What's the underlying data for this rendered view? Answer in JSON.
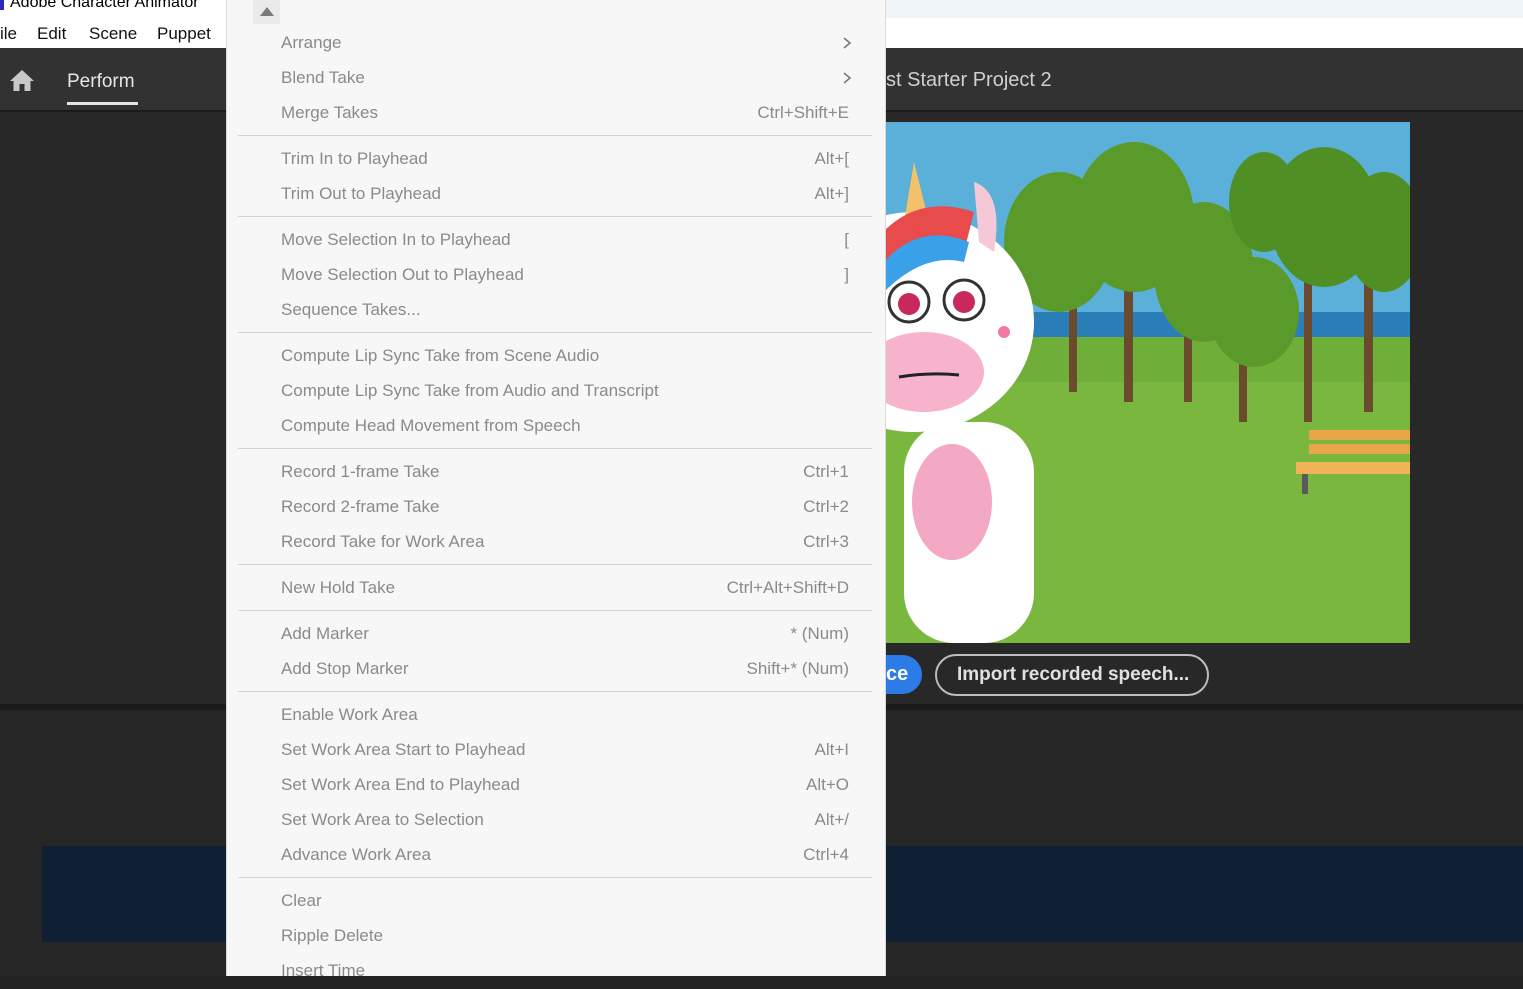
{
  "window": {
    "title": "Adobe Character Animator"
  },
  "menubar": {
    "items": [
      "ile",
      "Edit",
      "Scene",
      "Puppet"
    ]
  },
  "header": {
    "workspace_tab": "Perform",
    "project_title": "st Starter Project 2"
  },
  "scene_buttons": {
    "partial_button_text": "ce",
    "import_label": "Import recorded speech..."
  },
  "menu": {
    "groups": [
      [
        {
          "label": "Arrange",
          "shortcut": "",
          "submenu": true
        },
        {
          "label": "Blend Take",
          "shortcut": "",
          "submenu": true
        },
        {
          "label": "Merge Takes",
          "shortcut": "Ctrl+Shift+E"
        }
      ],
      [
        {
          "label": "Trim In to Playhead",
          "shortcut": "Alt+["
        },
        {
          "label": "Trim Out to Playhead",
          "shortcut": "Alt+]"
        }
      ],
      [
        {
          "label": "Move Selection In to Playhead",
          "shortcut": "["
        },
        {
          "label": "Move Selection Out to Playhead",
          "shortcut": "]"
        },
        {
          "label": "Sequence Takes...",
          "shortcut": ""
        }
      ],
      [
        {
          "label": "Compute Lip Sync Take from Scene Audio",
          "shortcut": ""
        },
        {
          "label": "Compute Lip Sync Take from Audio and Transcript",
          "shortcut": ""
        },
        {
          "label": "Compute Head Movement from Speech",
          "shortcut": ""
        }
      ],
      [
        {
          "label": "Record 1-frame Take",
          "shortcut": "Ctrl+1"
        },
        {
          "label": "Record 2-frame Take",
          "shortcut": "Ctrl+2"
        },
        {
          "label": "Record Take for Work Area",
          "shortcut": "Ctrl+3"
        }
      ],
      [
        {
          "label": "New Hold Take",
          "shortcut": "Ctrl+Alt+Shift+D"
        }
      ],
      [
        {
          "label": "Add Marker",
          "shortcut": "* (Num)"
        },
        {
          "label": "Add Stop Marker",
          "shortcut": "Shift+* (Num)"
        }
      ],
      [
        {
          "label": "Enable Work Area",
          "shortcut": ""
        },
        {
          "label": "Set Work Area Start to Playhead",
          "shortcut": "Alt+I"
        },
        {
          "label": "Set Work Area End to Playhead",
          "shortcut": "Alt+O"
        },
        {
          "label": "Set Work Area to Selection",
          "shortcut": "Alt+/"
        },
        {
          "label": "Advance Work Area",
          "shortcut": "Ctrl+4"
        }
      ],
      [
        {
          "label": "Clear",
          "shortcut": ""
        },
        {
          "label": "Ripple Delete",
          "shortcut": ""
        },
        {
          "label": "Insert Time",
          "shortcut": ""
        }
      ]
    ]
  },
  "colors": {
    "accent_blue": "#2d7be6",
    "menu_bg": "#f7f7f7",
    "menu_text_disabled": "#8a8a8a",
    "app_bg": "#232323"
  }
}
